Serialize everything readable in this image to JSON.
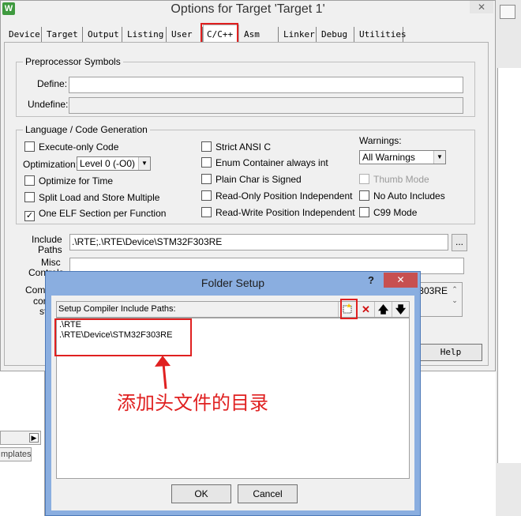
{
  "main_dialog": {
    "title": "Options for Target 'Target 1'",
    "close_glyph": "✕",
    "tabs": [
      "Device",
      "Target",
      "Output",
      "Listing",
      "User",
      "C/C++",
      "Asm",
      "Linker",
      "Debug",
      "Utilities"
    ],
    "active_tab": "C/C++",
    "preprocessor": {
      "legend": "Preprocessor Symbols",
      "define_label": "Define:",
      "define_value": "",
      "undefine_label": "Undefine:",
      "undefine_value": ""
    },
    "language": {
      "legend": "Language / Code Generation",
      "execute_only": "Execute-only Code",
      "optimization_label": "Optimization:",
      "optimization_value": "Level 0 (-O0)",
      "optimize_time": "Optimize for Time",
      "split_load": "Split Load and Store Multiple",
      "one_elf": "One ELF Section per Function",
      "strict_ansi": "Strict ANSI C",
      "enum_container": "Enum Container always int",
      "plain_char": "Plain Char is Signed",
      "ro_pos": "Read-Only Position Independent",
      "rw_pos": "Read-Write Position Independent",
      "warnings_label": "Warnings:",
      "warnings_value": "All Warnings",
      "thumb_mode": "Thumb Mode",
      "no_auto_includes": "No Auto Includes",
      "c99_mode": "C99 Mode"
    },
    "include_paths_label_1": "Include",
    "include_paths_label_2": "Paths",
    "include_paths_value": ".\\RTE;.\\RTE\\Device\\STM32F303RE",
    "browse_label": "...",
    "misc_label_1": "Misc",
    "misc_label_2": "Controls",
    "misc_value": "",
    "compiler_label_1": "Compi",
    "compiler_label_2": "con",
    "compiler_label_3": "st",
    "compiler_text": "303RE",
    "help_label": "Help"
  },
  "folder_dialog": {
    "title": "Folder Setup",
    "help_glyph": "?",
    "close_glyph": "✕",
    "list_header": "Setup Compiler Include Paths:",
    "paths": [
      ".\\RTE",
      ".\\RTE\\Device\\STM32F303RE"
    ],
    "ok_label": "OK",
    "cancel_label": "Cancel"
  },
  "annotation": "添加头文件的目录",
  "background": {
    "templates_tab": "mplates",
    "scroll_arrow": "▶"
  },
  "icons": [
    "app-icon",
    "new-folder-icon",
    "delete-icon",
    "move-up-icon",
    "move-down-icon",
    "dropdown-arrow-icon",
    "checkmark-icon",
    "annotation-arrow"
  ],
  "colors": {
    "highlight_red": "#e02020",
    "folder_frame": "#8aaee0",
    "close_red": "#c75050"
  }
}
